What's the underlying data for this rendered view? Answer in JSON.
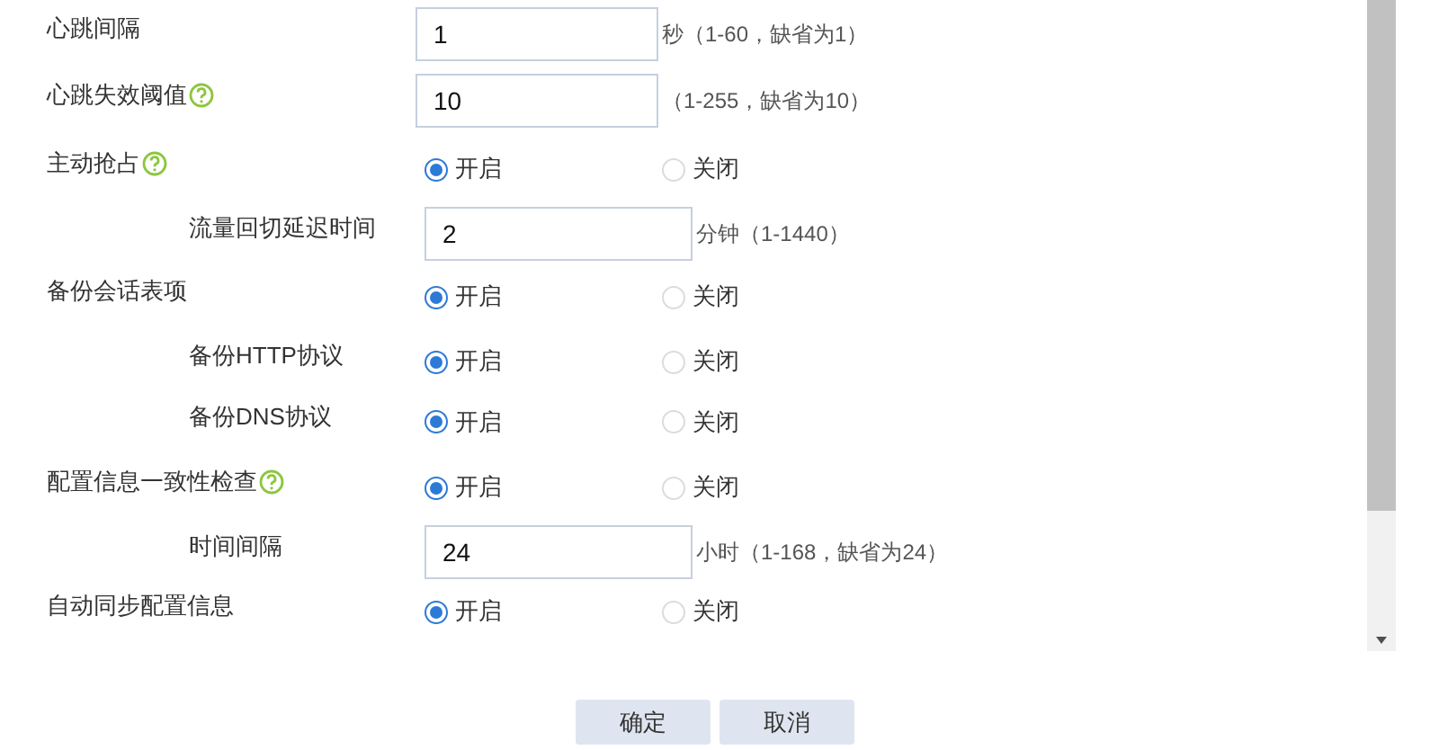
{
  "rows": [
    {
      "kind": "input",
      "label": "心跳间隔",
      "help": false,
      "value": "1",
      "hint": "秒（1-60，缺省为1）"
    },
    {
      "kind": "input",
      "label": "心跳失效阈值",
      "help": true,
      "value": "10",
      "hint": "（1-255，缺省为10）"
    },
    {
      "kind": "radio",
      "label": "主动抢占",
      "help": true,
      "options": [
        {
          "label": "开启",
          "selected": true
        },
        {
          "label": "关闭",
          "selected": false
        }
      ],
      "children": [
        {
          "kind": "input",
          "label": "流量回切延迟时间",
          "help": false,
          "value": "2",
          "hint": "分钟（1-1440）"
        }
      ]
    },
    {
      "kind": "radio",
      "label": "备份会话表项",
      "help": false,
      "options": [
        {
          "label": "开启",
          "selected": true
        },
        {
          "label": "关闭",
          "selected": false
        }
      ],
      "children": [
        {
          "kind": "radio",
          "label": "备份HTTP协议",
          "help": false,
          "options": [
            {
              "label": "开启",
              "selected": true
            },
            {
              "label": "关闭",
              "selected": false
            }
          ]
        },
        {
          "kind": "radio",
          "label": "备份DNS协议",
          "help": false,
          "options": [
            {
              "label": "开启",
              "selected": true
            },
            {
              "label": "关闭",
              "selected": false
            }
          ]
        }
      ]
    },
    {
      "kind": "radio",
      "label": "配置信息一致性检查",
      "help": true,
      "options": [
        {
          "label": "开启",
          "selected": true
        },
        {
          "label": "关闭",
          "selected": false
        }
      ],
      "children": [
        {
          "kind": "input",
          "label": "时间间隔",
          "help": false,
          "value": "24",
          "hint": "小时（1-168，缺省为24）"
        }
      ]
    },
    {
      "kind": "radio",
      "label": "自动同步配置信息",
      "help": false,
      "options": [
        {
          "label": "开启",
          "selected": true
        },
        {
          "label": "关闭",
          "selected": false
        }
      ]
    }
  ],
  "buttons": [
    "确定",
    "取消"
  ]
}
